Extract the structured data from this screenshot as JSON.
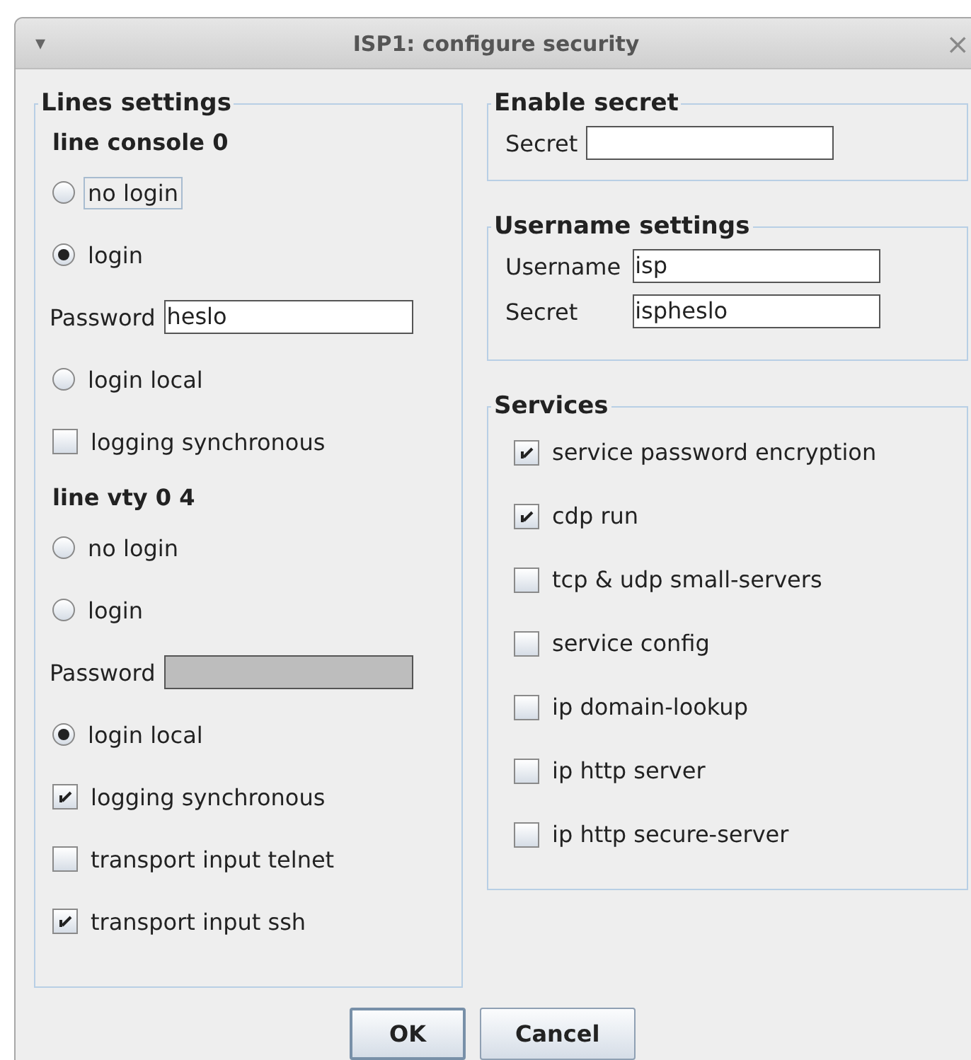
{
  "window": {
    "title": "ISP1: configure security",
    "menu_glyph": "▾",
    "close_glyph": "×"
  },
  "lines_settings": {
    "title": "Lines settings",
    "sections": [
      {
        "heading": "line console 0",
        "items": [
          {
            "kind": "radio",
            "label": "no login",
            "selected": false,
            "focused": true
          },
          {
            "kind": "radio",
            "label": "login",
            "selected": true,
            "focused": false
          },
          {
            "kind": "password",
            "label": "Password",
            "value": "heslo",
            "disabled": false
          },
          {
            "kind": "radio",
            "label": "login local",
            "selected": false,
            "focused": false
          },
          {
            "kind": "checkbox",
            "label": "logging synchronous",
            "checked": false
          }
        ]
      },
      {
        "heading": "line vty 0 4",
        "items": [
          {
            "kind": "radio",
            "label": "no login",
            "selected": false,
            "focused": false
          },
          {
            "kind": "radio",
            "label": "login",
            "selected": false,
            "focused": false
          },
          {
            "kind": "password",
            "label": "Password",
            "disabled": true
          },
          {
            "kind": "radio",
            "label": "login local",
            "selected": true,
            "focused": false
          },
          {
            "kind": "checkbox",
            "label": "logging synchronous",
            "checked": true
          },
          {
            "kind": "checkbox",
            "label": "transport input telnet",
            "checked": false
          },
          {
            "kind": "checkbox",
            "label": "transport input ssh",
            "checked": true
          }
        ]
      }
    ]
  },
  "enable_secret": {
    "title": "Enable secret",
    "label": "Secret"
  },
  "username_settings": {
    "title": "Username settings",
    "fields": [
      {
        "label": "Username",
        "value": "isp"
      },
      {
        "label": "Secret",
        "value": "ispheslo"
      }
    ]
  },
  "services": {
    "title": "Services",
    "items": [
      {
        "label": "service password encryption",
        "checked": true
      },
      {
        "label": "cdp run",
        "checked": true
      },
      {
        "label": "tcp & udp small-servers",
        "checked": false
      },
      {
        "label": "service config",
        "checked": false
      },
      {
        "label": "ip domain-lookup",
        "checked": false
      },
      {
        "label": "ip http server",
        "checked": false
      },
      {
        "label": "ip http secure-server",
        "checked": false
      }
    ]
  },
  "buttons": [
    {
      "label": "OK",
      "default": true
    },
    {
      "label": "Cancel",
      "default": false
    }
  ]
}
